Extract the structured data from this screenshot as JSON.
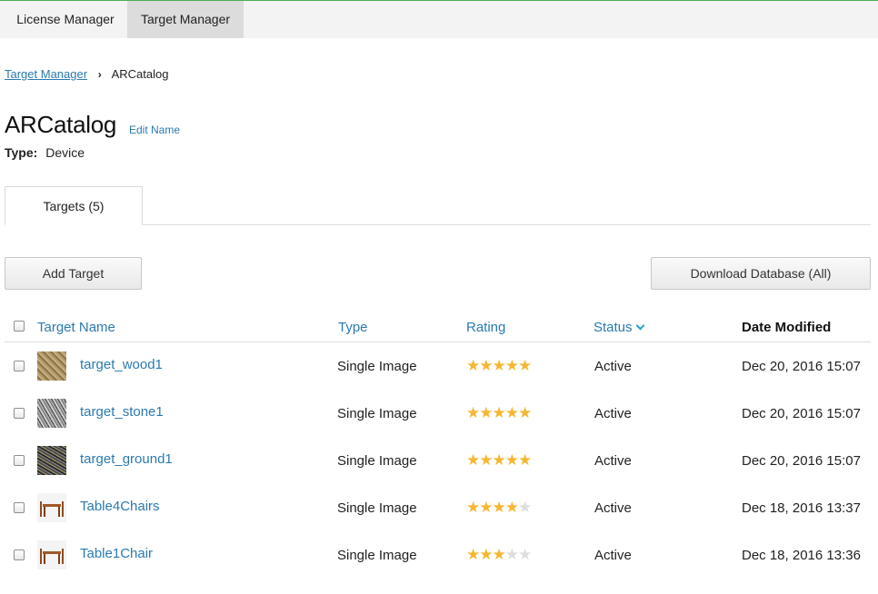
{
  "topnav": {
    "items": [
      {
        "label": "License Manager"
      },
      {
        "label": "Target Manager",
        "active": true
      }
    ]
  },
  "breadcrumb": {
    "link": "Target Manager",
    "current": "ARCatalog"
  },
  "database": {
    "name": "ARCatalog",
    "edit_label": "Edit Name",
    "type_label": "Type:",
    "type_value": "Device"
  },
  "tabs": [
    {
      "label": "Targets (5)",
      "active": true
    }
  ],
  "toolbar": {
    "add_label": "Add Target",
    "download_label": "Download Database (All)"
  },
  "table": {
    "columns": {
      "name": "Target Name",
      "type": "Type",
      "rating": "Rating",
      "status": "Status",
      "date": "Date Modified"
    },
    "rows": [
      {
        "name": "target_wood1",
        "type": "Single Image",
        "rating": 5,
        "status": "Active",
        "date": "Dec 20, 2016 15:07",
        "thumb": "wood"
      },
      {
        "name": "target_stone1",
        "type": "Single Image",
        "rating": 5,
        "status": "Active",
        "date": "Dec 20, 2016 15:07",
        "thumb": "stone"
      },
      {
        "name": "target_ground1",
        "type": "Single Image",
        "rating": 5,
        "status": "Active",
        "date": "Dec 20, 2016 15:07",
        "thumb": "ground"
      },
      {
        "name": "Table4Chairs",
        "type": "Single Image",
        "rating": 4,
        "status": "Active",
        "date": "Dec 18, 2016 13:37",
        "thumb": "furniture"
      },
      {
        "name": "Table1Chair",
        "type": "Single Image",
        "rating": 3,
        "status": "Active",
        "date": "Dec 18, 2016 13:36",
        "thumb": "furniture"
      }
    ]
  },
  "colors": {
    "link": "#2a7ab0",
    "star": "#f5b731",
    "star_empty": "#dddddd",
    "accent_top": "#4caf50"
  }
}
